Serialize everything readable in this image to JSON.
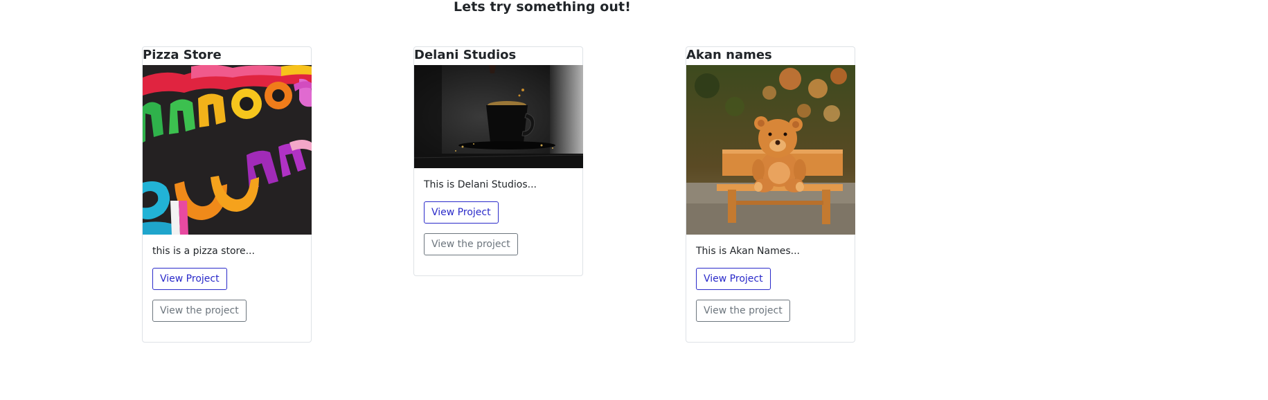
{
  "headline": "Lets try something out!",
  "cards": [
    {
      "title": "Pizza Store",
      "image": "colorful-felt-letters",
      "text": "this is a pizza store...",
      "primary_button": "View Project",
      "secondary_button": "View the project"
    },
    {
      "title": "Delani Studios",
      "image": "coffee-cup-splash",
      "text": "This is Delani Studios...",
      "primary_button": "View Project",
      "secondary_button": "View the project"
    },
    {
      "title": "Akan names",
      "image": "teddy-bear-on-bench",
      "text": "This is Akan Names...",
      "primary_button": "View Project",
      "secondary_button": "View the project"
    }
  ],
  "colors": {
    "primary": "#2929c9",
    "secondary": "#6c757d",
    "border": "#dee2e6",
    "text": "#212529"
  }
}
